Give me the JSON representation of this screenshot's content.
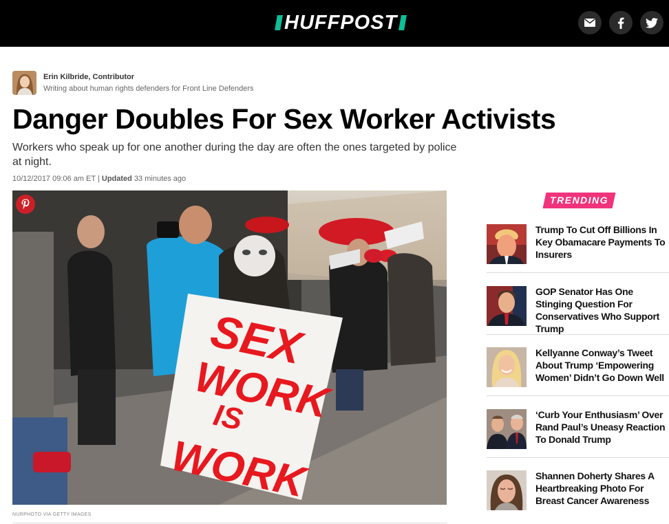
{
  "header": {
    "logo_text": "HUFFPOST",
    "brand_color": "#0dbe98",
    "share_buttons": [
      {
        "name": "mail",
        "icon": "envelope-icon"
      },
      {
        "name": "facebook",
        "icon": "facebook-icon"
      },
      {
        "name": "twitter",
        "icon": "twitter-icon"
      }
    ]
  },
  "byline": {
    "author": "Erin Kilbride, Contributor",
    "description": "Writing about human rights defenders for Front Line Defenders"
  },
  "article": {
    "headline": "Danger Doubles For Sex Worker Activists",
    "dek": "Workers who speak up for one another during the day are often the ones targeted by police at night.",
    "date": "10/12/2017 09:06 am ET",
    "separator": "|",
    "updated_label": "Updated",
    "updated_ago": "33 minutes ago",
    "photo": {
      "sign_lines": [
        "SEX",
        "WORK",
        "IS",
        "WORK"
      ],
      "credit": "NURPHOTO VIA GETTY IMAGES"
    }
  },
  "trending": {
    "label": "TRENDING",
    "accent_color": "#f0337a",
    "items": [
      {
        "title": "Trump To Cut Off Billions In Key Obamacare Payments To Insurers"
      },
      {
        "title": "GOP Senator Has One Stinging Question For Conservatives Who Support Trump"
      },
      {
        "title": "Kellyanne Conway’s Tweet About Trump ‘Empowering Women’ Didn’t Go Down Well"
      },
      {
        "title": "‘Curb Your Enthusiasm’ Over Rand Paul’s Uneasy Reaction To Donald Trump"
      },
      {
        "title": "Shannen Doherty Shares A Heartbreaking Photo For Breast Cancer Awareness"
      }
    ]
  }
}
